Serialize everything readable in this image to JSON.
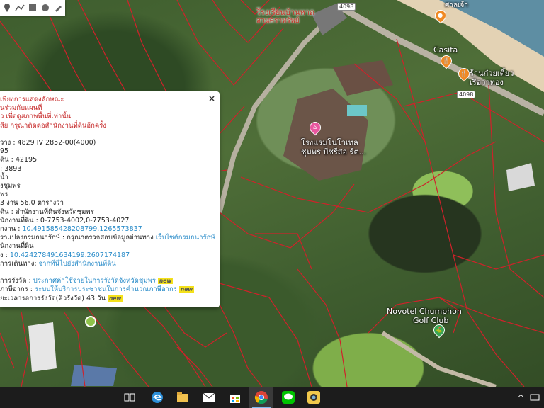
{
  "map": {
    "labels": {
      "hotel_top": "โรงเรียนบ้านหาด",
      "hotel_top_sub": "สวนคราทรัพย์",
      "resort": "โรงแรมโนโวเทล",
      "resort_sub": "ชุมพร บีชรีสอ ร์ต...",
      "casita": "Casita",
      "noodle": "ร้านก๋วยเตี๋ยว",
      "noodle_sub": "เรือวาทอง",
      "top_right": "ศาลเจ้า",
      "golf": "Novotel Chumphon",
      "golf_sub": "Golf Club",
      "road_top": "4098",
      "road_mid": "4098"
    }
  },
  "popup": {
    "close_label": "×",
    "lines": [
      {
        "text": "เพียงการแสดงลักษณะ",
        "style": "warn"
      },
      {
        "text": "นร่วมกับแผนที่",
        "style": "warn"
      },
      {
        "text": "ว เพื่อดูสภาพพื้นที่เท่านั้น",
        "style": "warn"
      },
      {
        "text": "สีย กรุณาติดต่อสำนักงานที่ดินอีกครั้ง",
        "style": "warn"
      },
      {
        "text": "",
        "style": ""
      },
      {
        "text": "วาง : 4829 IV 2852-00(4000)",
        "style": ""
      },
      {
        "text": "95",
        "style": ""
      },
      {
        "text": "ดิน : 42195",
        "style": ""
      },
      {
        "text": ": 3893",
        "style": ""
      },
      {
        "text": "น้ำ",
        "style": ""
      },
      {
        "text": "งชุมพร",
        "style": ""
      },
      {
        "text": "พร",
        "style": ""
      },
      {
        "text": "3 งาน 56.0 ตารางวา",
        "style": ""
      },
      {
        "text": "ดิน : สำนักงานที่ดินจังหวัดชุมพร",
        "style": ""
      },
      {
        "text": "นักงานที่ดิน : 0-7753-4002,0-7753-4027",
        "style": ""
      },
      {
        "text": "กงาน : 10.491585428208799.1265573837",
        "style": "coord"
      },
      {
        "text": "ราแปลงกรมธนารักษ์ : กรุณาตรวจสอบข้อมูลผ่านทาง ",
        "style": "mixed",
        "link": "เว็บไซต์กรมธนารักษ์"
      },
      {
        "text": "นักงานที่ดิน",
        "style": ""
      },
      {
        "text": "ง : 10.424278491634199.2607174187",
        "style": "coord"
      },
      {
        "text": "การเดินทาง: ",
        "style": "mixed",
        "link": "จากที่นี่ไปยังสำนักงานที่ดิน"
      },
      {
        "text": "",
        "style": ""
      },
      {
        "text": "การรังวัด : ",
        "style": "mixed",
        "link": "ประกาศค่าใช้จ่ายในการรังวัดจังหวัดชุมพร",
        "new": "new"
      },
      {
        "text": "ภาษีอากร : ",
        "style": "mixed",
        "link": "ระบบให้บริการประชาชนในการคำนวณภาษีอากร",
        "new": "new"
      },
      {
        "text": "ยะเวลารอการรังวัด(คิวรังวัด) 43 วัน",
        "style": "",
        "new": "new"
      }
    ]
  },
  "toolbar": {
    "tools": [
      "marker-tool",
      "polyline-tool",
      "rectangle-tool",
      "circle-tool",
      "pen-tool"
    ]
  },
  "taskbar": {
    "apps": [
      "task-view",
      "edge",
      "file-explorer",
      "mail",
      "store",
      "chrome",
      "line",
      "camera"
    ],
    "tray_chevron": "^"
  },
  "colors": {
    "parcel_lines": "#d0212a",
    "warning_text": "#c62828",
    "link_text": "#2a8cc9",
    "taskbar": "#1c1c1c"
  }
}
